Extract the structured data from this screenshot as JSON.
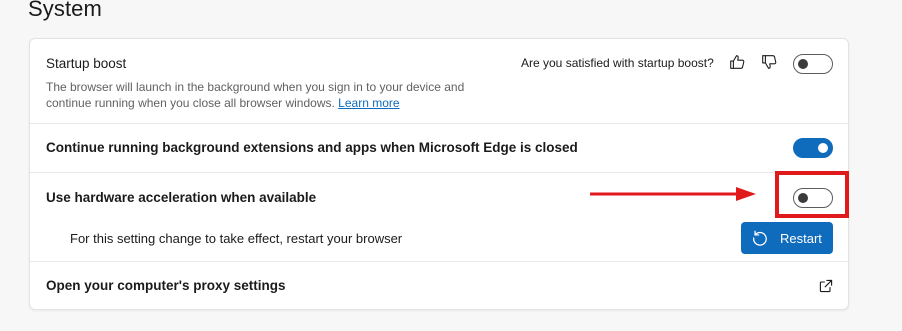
{
  "section": {
    "title": "System"
  },
  "startup_boost": {
    "title": "Startup boost",
    "description": "The browser will launch in the background when you sign in to your device and continue running when you close all browser windows.",
    "learn_more": "Learn more",
    "feedback_question": "Are you satisfied with startup boost?",
    "enabled": false
  },
  "background_extensions": {
    "title": "Continue running background extensions and apps when Microsoft Edge is closed",
    "enabled": true
  },
  "hardware_acceleration": {
    "title": "Use hardware acceleration when available",
    "enabled": false,
    "restart_notice": "For this setting change to take effect, restart your browser",
    "restart_label": "Restart"
  },
  "proxy": {
    "title": "Open your computer's proxy settings"
  },
  "colors": {
    "accent": "#0f6cbd",
    "annotation": "#e0191b"
  },
  "icons": {
    "thumb_up": "thumbs-up-icon",
    "thumb_down": "thumbs-down-icon",
    "restart": "restart-icon",
    "external": "external-link-icon"
  }
}
